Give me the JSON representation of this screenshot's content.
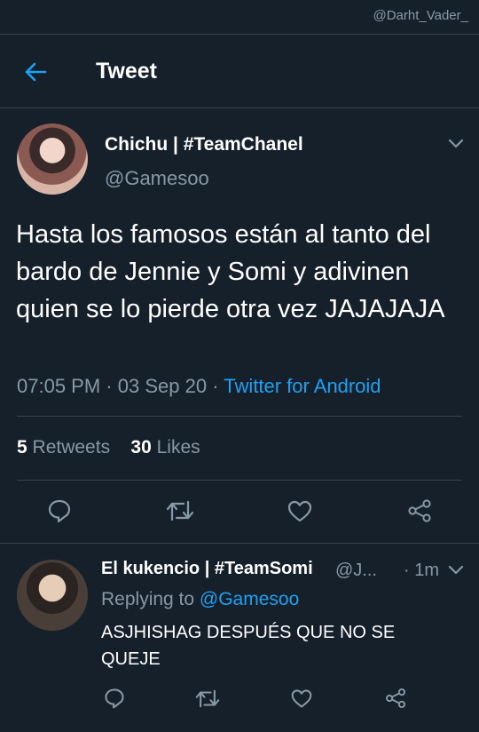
{
  "watermark": "@Darht_Vader_",
  "header": {
    "title": "Tweet"
  },
  "tweet": {
    "display_name": "Chichu | #TeamChanel",
    "handle": "@Gamesoo",
    "text": "Hasta los famosos están al tanto del bardo de Jennie y Somi y adivinen quien se lo pierde otra vez JAJAJAJA",
    "time": "07:05 PM",
    "date": "03 Sep 20",
    "separator": "·",
    "source": "Twitter for Android",
    "retweets_count": "5",
    "retweets_label": "Retweets",
    "likes_count": "30",
    "likes_label": "Likes"
  },
  "reply": {
    "display_name": "El kukencio | #TeamSomi",
    "handle": "@J...",
    "time": "· 1m",
    "replying_prefix": "Replying to",
    "replying_to": "@Gamesoo",
    "text": "ASJHISHAG DESPUÉS QUE NO SE QUEJE"
  },
  "icons": [
    "back-arrow-icon",
    "chevron-down-icon",
    "reply-icon",
    "retweet-icon",
    "like-icon",
    "share-icon"
  ],
  "colors": {
    "background": "#15202b",
    "accent": "#1da1f2",
    "muted": "#8899a6",
    "border": "#38444d"
  }
}
